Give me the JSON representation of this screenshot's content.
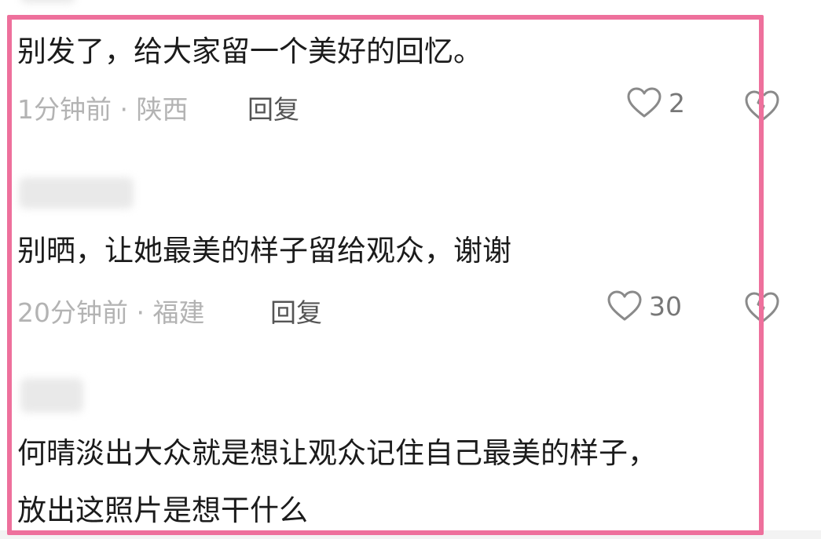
{
  "comments": [
    {
      "text": "别发了，给大家留一个美好的回忆。",
      "time_location": "1分钟前 · 陕西",
      "reply_label": "回复",
      "like_count": "2"
    },
    {
      "text": "别晒，让她最美的样子留给观众，谢谢",
      "time_location": "20分钟前 · 福建",
      "reply_label": "回复",
      "like_count": "30"
    },
    {
      "text_line1": "何晴淡出大众就是想让观众记住自己最美的样子，",
      "text_line2": "放出这照片是想干什么"
    }
  ],
  "colors": {
    "highlight_border": "#ee709c",
    "meta_text": "#b3b3b3",
    "icon_stroke": "#8a8a8a"
  },
  "icons": [
    "heart-outline-icon",
    "broken-heart-icon"
  ]
}
